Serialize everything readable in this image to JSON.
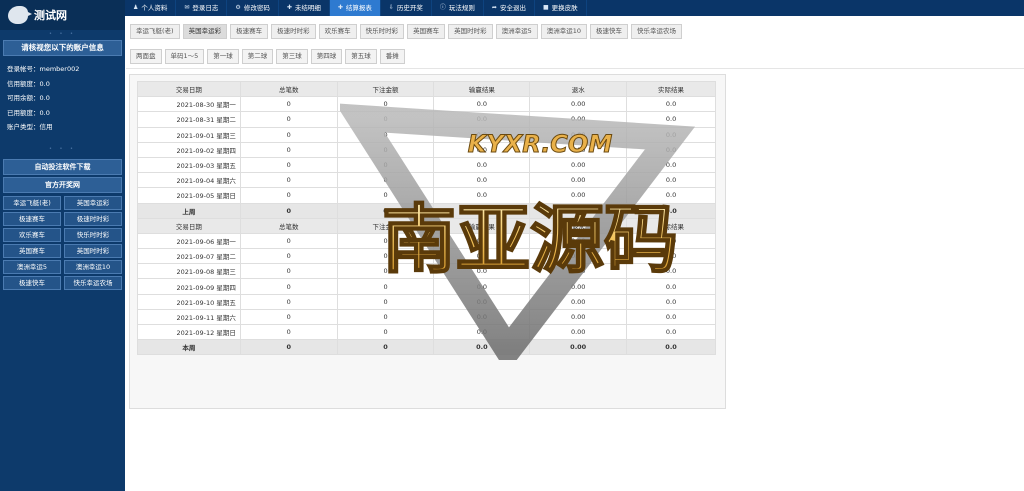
{
  "brand": {
    "name": "测试网"
  },
  "topnav": [
    {
      "label": "个人资料",
      "icon": "user-icon"
    },
    {
      "label": "登录日志",
      "icon": "chat-icon"
    },
    {
      "label": "修改密码",
      "icon": "gear-icon"
    },
    {
      "label": "未结明细",
      "icon": "plus-icon"
    },
    {
      "label": "结算报表",
      "icon": "plus-icon"
    },
    {
      "label": "历史开奖",
      "icon": "download-icon"
    },
    {
      "label": "玩法规则",
      "icon": "info-icon"
    },
    {
      "label": "安全退出",
      "icon": "logout-icon"
    },
    {
      "label": "更换皮肤",
      "icon": "trash-icon"
    }
  ],
  "sidebar": {
    "account_header": "请核视您以下的账户信息",
    "info": [
      "登录帐号：member002",
      "信用额度：0.0",
      "可用余额：0.0",
      "已用额度：0.0",
      "账户类型：信用"
    ],
    "download_button": "自动投注软件下载",
    "official_header": "官方开奖网",
    "lotteries": [
      "幸运飞艇(老)",
      "英国幸运彩",
      "极速赛车",
      "极速时时彩",
      "欢乐赛车",
      "快乐时时彩",
      "英国赛车",
      "英国时时彩",
      "澳洲幸运5",
      "澳洲幸运10",
      "极速快车",
      "快乐幸运农场"
    ]
  },
  "tabs": [
    "幸运飞艇(老)",
    "英国幸运彩",
    "极速赛车",
    "极速时时彩",
    "欢乐赛车",
    "快乐时时彩",
    "英国赛车",
    "英国时时彩",
    "澳洲幸运5",
    "澳洲幸运10",
    "极速快车",
    "快乐幸运农场"
  ],
  "ballbar": [
    "两面盘",
    "单码1～5",
    "第一球",
    "第二球",
    "第三球",
    "第四球",
    "第五球",
    "番摊"
  ],
  "table": {
    "headers": [
      "交易日期",
      "总笔数",
      "下注金额",
      "输赢结果",
      "退水",
      "实际结果"
    ],
    "week1": [
      [
        "2021-08-30 星期一",
        "0",
        "0",
        "0.0",
        "0.00",
        "0.0"
      ],
      [
        "2021-08-31 星期二",
        "0",
        "0",
        "0.0",
        "0.00",
        "0.0"
      ],
      [
        "2021-09-01 星期三",
        "0",
        "0",
        "0.0",
        "0.00",
        "0.0"
      ],
      [
        "2021-09-02 星期四",
        "0",
        "0",
        "0.0",
        "0.00",
        "0.0"
      ],
      [
        "2021-09-03 星期五",
        "0",
        "0",
        "0.0",
        "0.00",
        "0.0"
      ],
      [
        "2021-09-04 星期六",
        "0",
        "0",
        "0.0",
        "0.00",
        "0.0"
      ],
      [
        "2021-09-05 星期日",
        "0",
        "0",
        "0.0",
        "0.00",
        "0.0"
      ]
    ],
    "week1_total": [
      "上周",
      "0",
      "0",
      "0.0",
      "0.00",
      "0.0"
    ],
    "week2": [
      [
        "2021-09-06 星期一",
        "0",
        "0",
        "0.0",
        "0.00",
        "0.0"
      ],
      [
        "2021-09-07 星期二",
        "0",
        "0",
        "0.0",
        "0.00",
        "0.0"
      ],
      [
        "2021-09-08 星期三",
        "0",
        "0",
        "0.0",
        "0.00",
        "0.0"
      ],
      [
        "2021-09-09 星期四",
        "0",
        "0",
        "0.0",
        "0.00",
        "0.0"
      ],
      [
        "2021-09-10 星期五",
        "0",
        "0",
        "0.0",
        "0.00",
        "0.0"
      ],
      [
        "2021-09-11 星期六",
        "0",
        "0",
        "0.0",
        "0.00",
        "0.0"
      ],
      [
        "2021-09-12 星期日",
        "0",
        "0",
        "0.0",
        "0.00",
        "0.0"
      ]
    ],
    "week2_total": [
      "本周",
      "0",
      "0",
      "0.0",
      "0.00",
      "0.0"
    ]
  },
  "watermark": {
    "top_text": "KYXR.COM",
    "main_text": "南亚源码"
  }
}
